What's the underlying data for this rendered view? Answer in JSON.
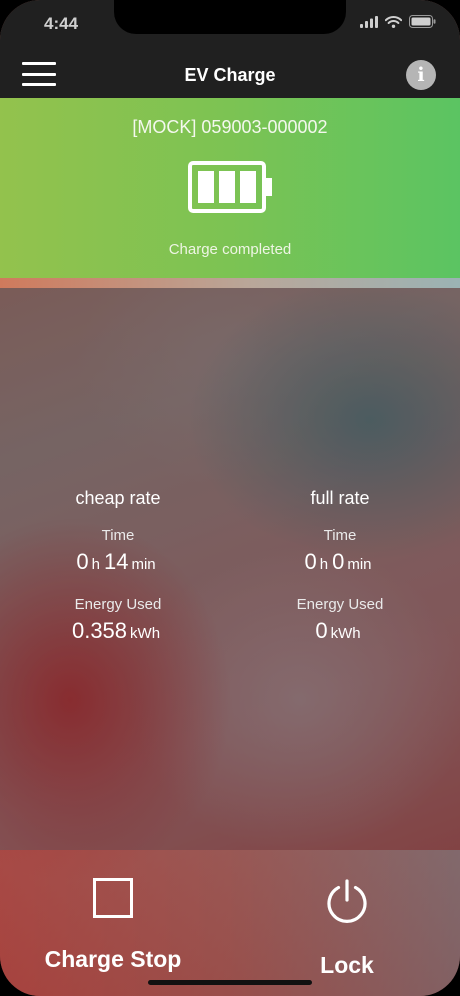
{
  "status_bar": {
    "time": "4:44"
  },
  "nav": {
    "title": "EV Charge",
    "info_label": "i"
  },
  "charger": {
    "id": "[MOCK] 059003-000002",
    "status": "Charge completed",
    "battery_level": 1.0,
    "battery_bars": 3,
    "accent_color": "#7cc353"
  },
  "usage": {
    "cheap": {
      "title": "cheap rate",
      "time_label": "Time",
      "hours": "0",
      "hours_unit": "h",
      "minutes": "14",
      "minutes_unit": "min",
      "energy_label": "Energy Used",
      "energy": "0.358",
      "energy_unit": "kWh"
    },
    "full": {
      "title": "full rate",
      "time_label": "Time",
      "hours": "0",
      "hours_unit": "h",
      "minutes": "0",
      "minutes_unit": "min",
      "energy_label": "Energy Used",
      "energy": "0",
      "energy_unit": "kWh"
    }
  },
  "actions": {
    "stop_label": "Charge Stop",
    "lock_label": "Lock"
  },
  "icons": {
    "menu": "hamburger-menu-icon",
    "info": "info-icon",
    "battery": "battery-full-icon",
    "stop": "stop-square-icon",
    "power": "power-icon"
  }
}
